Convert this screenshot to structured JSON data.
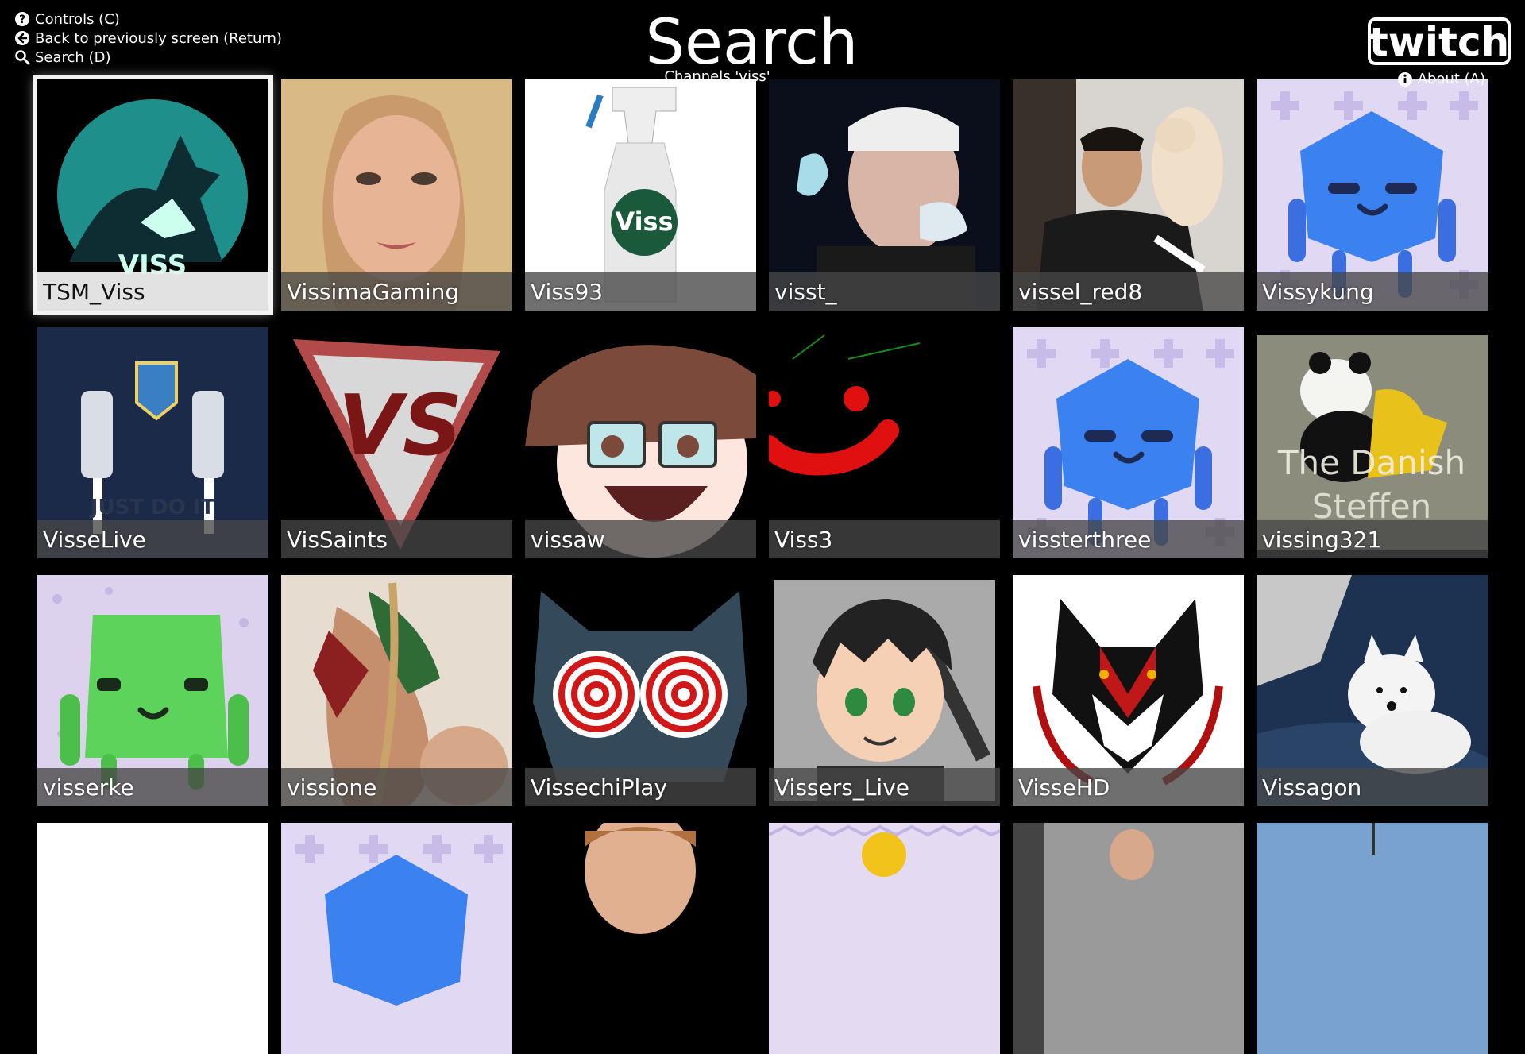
{
  "hints": [
    {
      "icon": "question-circle-icon",
      "label": "Controls (C)"
    },
    {
      "icon": "arrow-left-circle-icon",
      "label": "Back to previously screen (Return)"
    },
    {
      "icon": "search-icon",
      "label": "Search (D)"
    }
  ],
  "header": {
    "title": "Search",
    "subtitle": "Channels 'viss'",
    "logo_text": "twitch",
    "about_label": "About (A)",
    "about_icon": "info-circle-icon"
  },
  "colors": {
    "background": "#000000",
    "selected_border": "#f3f3f3",
    "label_bar": "#464646",
    "twitch_logo": "#ffffff"
  },
  "channels": [
    {
      "name": "TSM_Viss",
      "selected": true,
      "avatar": "howling-wolf-moon",
      "thumb_text": "VISS"
    },
    {
      "name": "VissimaGaming",
      "avatar": "blonde-woman-selfie"
    },
    {
      "name": "Viss93",
      "avatar": "viss-spray-bottle",
      "thumb_text": "Viss"
    },
    {
      "name": "visst_",
      "avatar": "cartoon-man-portrait"
    },
    {
      "name": "vissel_red8",
      "avatar": "man-with-cat"
    },
    {
      "name": "Vissykung",
      "avatar": "blue-glitch-default"
    },
    {
      "name": "VisseLive",
      "avatar": "football-crest",
      "thumb_text": "JUST DO IT"
    },
    {
      "name": "VisSaints",
      "avatar": "vs-triangle-logo",
      "thumb_text": "VS"
    },
    {
      "name": "vissaw",
      "avatar": "cartoon-face-glasses"
    },
    {
      "name": "Viss3",
      "avatar": "red-smiley-drawing"
    },
    {
      "name": "vissterthree",
      "avatar": "blue-glitch-default"
    },
    {
      "name": "vissing321",
      "avatar": "panda-photo",
      "thumb_text": "The Danish Steffen"
    },
    {
      "name": "visserke",
      "avatar": "green-glitch-default"
    },
    {
      "name": "vissione",
      "avatar": "anime-figure-art"
    },
    {
      "name": "VissechiPlay",
      "avatar": "hypno-cat"
    },
    {
      "name": "Vissers_Live",
      "avatar": "anime-boy-sword"
    },
    {
      "name": "VisseHD",
      "avatar": "wolf-emblem"
    },
    {
      "name": "Vissagon",
      "avatar": "white-puppy-photo"
    },
    {
      "name": "",
      "avatar": "white-blank"
    },
    {
      "name": "",
      "avatar": "purple-glitch-default"
    },
    {
      "name": "",
      "avatar": "person-photo"
    },
    {
      "name": "",
      "avatar": "zigzag-pattern"
    },
    {
      "name": "",
      "avatar": "man-portrait"
    },
    {
      "name": "",
      "avatar": "outdoor-photo"
    }
  ]
}
